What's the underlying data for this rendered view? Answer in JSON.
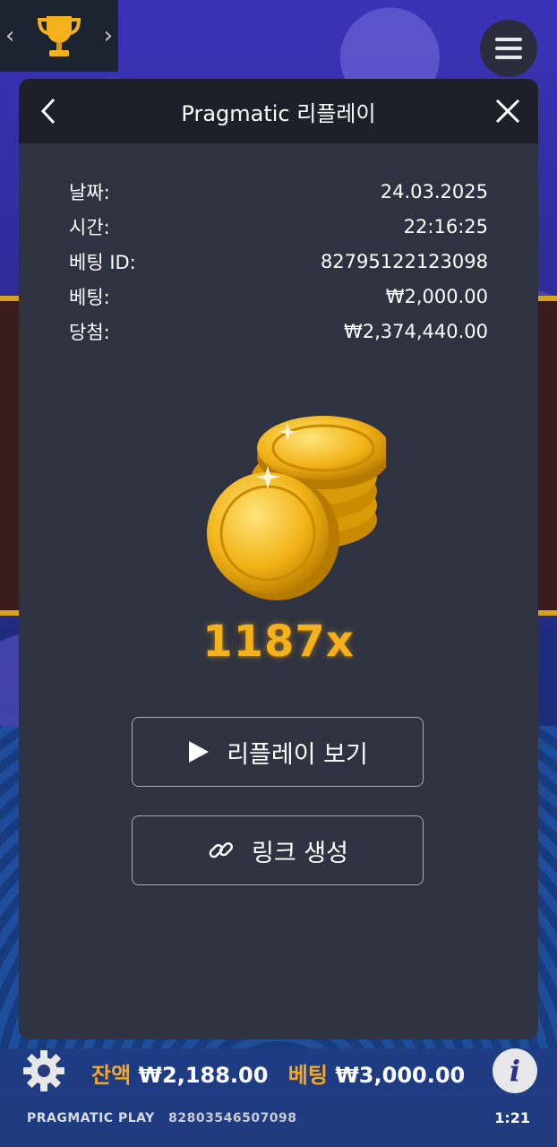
{
  "modal": {
    "title": "Pragmatic 리플레이",
    "details": [
      {
        "label": "날짜:",
        "value": "24.03.2025"
      },
      {
        "label": "시간:",
        "value": "22:16:25"
      },
      {
        "label": "베팅 ID:",
        "value": "82795122123098"
      },
      {
        "label": "베팅:",
        "value": "₩2,000.00"
      },
      {
        "label": "당첨:",
        "value": "₩2,374,440.00"
      }
    ],
    "multiplier": "1187x",
    "replay_button": "리플레이 보기",
    "link_button": "링크 생성"
  },
  "bottom": {
    "balance_label": "잔액",
    "balance_value": "₩2,188.00",
    "bet_label": "베팅",
    "bet_value": "₩3,000.00",
    "provider": "PRAGMATIC PLAY",
    "session_id": "82803546507098",
    "time": "1:21"
  },
  "icons": {
    "trophy": "trophy-icon",
    "menu": "hamburger-menu-icon",
    "back": "chevron-left-icon",
    "close": "close-icon",
    "play": "play-icon",
    "link": "link-icon",
    "settings": "gear-icon",
    "info": "info-icon"
  },
  "colors": {
    "modal_bg": "#2f3240",
    "header_bg": "#1d2029",
    "accent_gold": "#f3b11c",
    "label_orange": "#f5a623"
  }
}
